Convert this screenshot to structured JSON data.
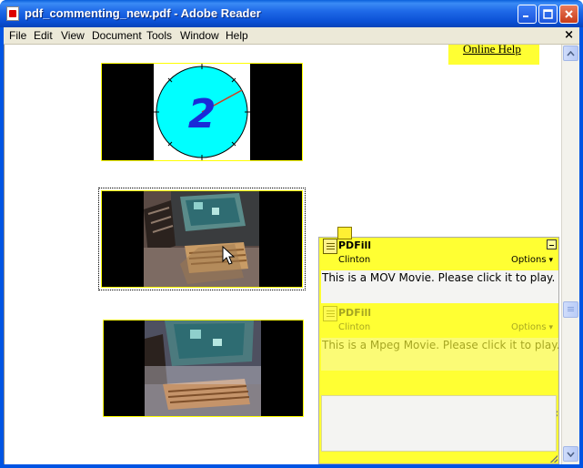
{
  "window": {
    "title": "pdf_commenting_new.pdf - Adobe Reader",
    "controls": [
      "minimize",
      "maximize",
      "close"
    ]
  },
  "menubar": {
    "items": [
      "File",
      "Edit",
      "View",
      "Document",
      "Tools",
      "Window",
      "Help"
    ],
    "close_glyph": "×"
  },
  "document": {
    "help_link": "Online Help",
    "clock_digit": "2",
    "media_border_color": "#ffff00"
  },
  "comments": [
    {
      "author": "PDFill",
      "user": "Clinton",
      "options_label": "Options",
      "text": "This is a MOV Movie. Please click it to play."
    },
    {
      "author": "PDFill",
      "user": "Clinton",
      "options_label": "Options",
      "text": "This is a Mpeg Movie. Please click it to play."
    }
  ],
  "colors": {
    "titlebar": "#0a4fd4",
    "note_yellow": "#ffff33",
    "clock_face": "#00ffff",
    "clock_digit": "#1a2ad8",
    "clock_hand": "#d23c1e"
  },
  "icons": {
    "title": "pdf-icon",
    "note": "note-icon",
    "sticky": "sticky-note-icon",
    "cursor": "pointer-cursor-icon"
  }
}
